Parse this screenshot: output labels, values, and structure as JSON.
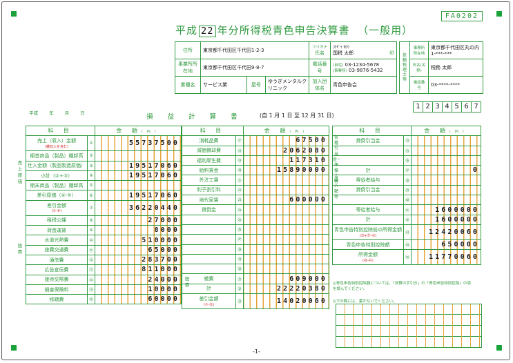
{
  "form_id": "FA0202",
  "title": {
    "prefix": "平成",
    "year": "22",
    "suffix": "年分所得税青色申告決算書",
    "kind": "（一般用）"
  },
  "header": {
    "address_label": "住所",
    "address": "東京都千代田区千代田1-2-3",
    "furigana_label": "フリガナ",
    "furigana": "ｺｸｾﾞｲ ﾀﾛｳ",
    "name_label": "氏名",
    "name": "国税 太郎",
    "seal": "㊞",
    "biz_addr_label": "事業所所在地",
    "biz_addr": "東京都千代田区千代田9-8-7",
    "tel_label": "電話番号",
    "tel_home_label": "(自宅)",
    "tel_home": "03-1234-5678",
    "tel_biz_label": "(事業所)",
    "tel_biz": "03-9876-5432",
    "industry_label": "業種名",
    "industry": "サービス業",
    "shop_label": "屋号",
    "shop": "ゆうぎメンタルクリニック",
    "assoc_label": "加入団体名",
    "assoc": "青色申告会",
    "agent_side_label": "依頼税理士等",
    "agent_addr_label": "事務所所在地",
    "agent_addr": "東京都千代田区丸の内",
    "agent_addr2": "1-***-***",
    "agent_name_label": "氏名(名称)",
    "agent_name": "税務 太郎",
    "agent_tel_label": "電話番号",
    "agent_tel": "03-****-****"
  },
  "code_digits": [
    "1",
    "2",
    "3",
    "4",
    "5",
    "6",
    "7"
  ],
  "era_line": "平成 年 月 日",
  "sheet_title": "損 益 計 算 書",
  "period": "(自 1 月 1 日 至 12 月 31 日)",
  "column_head": {
    "item": "科 目",
    "amount": "金 額",
    "unit": "(円)"
  },
  "col1": {
    "rows": [
      {
        "name": "売上（収入）金額",
        "sub": "(雑収入を含む)",
        "num": "①",
        "amount": "55737500"
      },
      {
        "name": "期首商品（製品）棚卸高",
        "num": "②",
        "amount": ""
      },
      {
        "name": "仕入金額（製品製造原価）",
        "num": "③",
        "amount": "19517060"
      },
      {
        "name": "小計（②+③）",
        "num": "④",
        "amount": "19517060"
      },
      {
        "name": "期末商品（製品）棚卸高",
        "num": "⑤",
        "amount": ""
      },
      {
        "name": "差引原価（④-⑤）",
        "num": "⑥",
        "amount": "19517060"
      },
      {
        "name": "差引金額",
        "sub": "(①-⑥)",
        "num": "⑦",
        "amount": "36220440"
      },
      {
        "name": "租税公課",
        "num": "⑧",
        "amount": "27000"
      },
      {
        "name": "荷造運賃",
        "num": "⑨",
        "amount": "8000"
      },
      {
        "name": "水道光熱費",
        "num": "⑩",
        "amount": "510000"
      },
      {
        "name": "旅費交通費",
        "num": "⑪",
        "amount": "65000"
      },
      {
        "name": "通信費",
        "num": "⑫",
        "amount": "283700"
      },
      {
        "name": "広告宣伝費",
        "num": "⑬",
        "amount": "811000"
      },
      {
        "name": "接待交際費",
        "num": "⑭",
        "amount": "24000"
      },
      {
        "name": "損害保険料",
        "num": "⑮",
        "amount": "10000"
      },
      {
        "name": "修繕費",
        "num": "⑯",
        "amount": "60000"
      }
    ],
    "side_sales": "売上原価",
    "side_exp": "経費"
  },
  "col2": {
    "rows": [
      {
        "name": "消耗品費",
        "num": "⑰",
        "amount": "67500"
      },
      {
        "name": "減価償却費",
        "num": "⑱",
        "amount": "2062080"
      },
      {
        "name": "福利厚生費",
        "num": "⑲",
        "amount": "117310"
      },
      {
        "name": "給料賃金",
        "num": "⑳",
        "amount": "15890000"
      },
      {
        "name": "外注工賃",
        "num": "㉑",
        "amount": ""
      },
      {
        "name": "利子割引料",
        "num": "㉒",
        "amount": ""
      },
      {
        "name": "地代家賃",
        "num": "㉓",
        "amount": "600000"
      },
      {
        "name": "貸倒金",
        "num": "㉔",
        "amount": ""
      },
      {
        "name": "",
        "num": "㉕",
        "amount": ""
      },
      {
        "name": "",
        "num": "㉖",
        "amount": ""
      },
      {
        "name": "",
        "num": "㉗",
        "amount": ""
      },
      {
        "name": "",
        "num": "㉘",
        "amount": ""
      },
      {
        "name": "",
        "num": "㉙",
        "amount": ""
      },
      {
        "name": "",
        "num": "㉚",
        "amount": ""
      },
      {
        "name": "雑費",
        "num": "㉛",
        "amount": "609000"
      },
      {
        "name": "計",
        "num": "㉜",
        "amount": "22220380"
      },
      {
        "name": "差引金額",
        "sub": "(⑦-㉜)",
        "num": "㉝",
        "amount": "14020060"
      }
    ],
    "side_exp": "経費"
  },
  "col3": {
    "rows": [
      {
        "name": "貸倒引当金",
        "num": "㉞",
        "amount": ""
      },
      {
        "name": "",
        "num": "㉟",
        "amount": ""
      },
      {
        "name": "",
        "num": "㊱",
        "amount": ""
      },
      {
        "name": "計",
        "num": "㊲",
        "amount": "0"
      },
      {
        "name": "専従者給与",
        "num": "㊳",
        "amount": ""
      },
      {
        "name": "貸倒引当金",
        "num": "㊴",
        "amount": ""
      },
      {
        "name": "",
        "num": "㊵",
        "amount": ""
      },
      {
        "name": "専従者給与",
        "num": "㊶",
        "amount": "1600000"
      },
      {
        "name": "計",
        "num": "㊷",
        "amount": "1600000"
      },
      {
        "name": "青色申告特別控除前の所得金額",
        "sub": "(㉝+㊲-㊷)",
        "num": "㊸",
        "amount": "12420060"
      },
      {
        "name": "青色申告特別控除額",
        "num": "㊹",
        "amount": "650000"
      },
      {
        "name": "所得金額",
        "sub": "(㊸-㊹)",
        "num": "㊺",
        "amount": "11770060"
      }
    ],
    "side_top": "各種引当金・準備金等",
    "side_mid": "繰入額等"
  },
  "notes": {
    "n1": "◎青色申告特別控除額については、「決算の手引き」の「青色申告特別控除」の項を読んでください。",
    "n2": "◎下の欄には、書かないでください。"
  },
  "page_number": "-1-"
}
